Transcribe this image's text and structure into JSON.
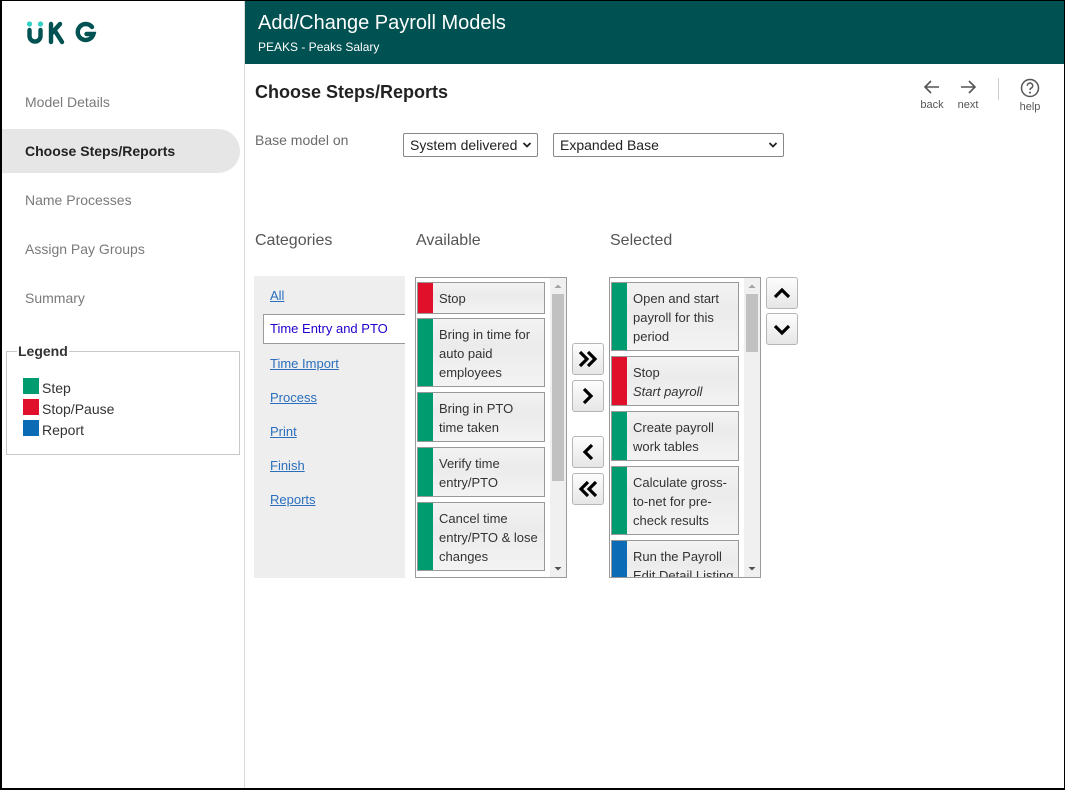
{
  "brand": {
    "logo_text": "UKG",
    "primary_color": "#005151",
    "accent_color": "#33d0c5"
  },
  "header": {
    "title": "Add/Change Payroll Models",
    "subtitle": "PEAKS - Peaks Salary"
  },
  "sidebar": {
    "items": [
      {
        "label": "Model Details",
        "active": false
      },
      {
        "label": "Choose Steps/Reports",
        "active": true
      },
      {
        "label": "Name Processes",
        "active": false
      },
      {
        "label": "Assign Pay Groups",
        "active": false
      },
      {
        "label": "Summary",
        "active": false
      }
    ],
    "legend": {
      "title": "Legend",
      "items": [
        {
          "label": "Step",
          "color": "#009b6e"
        },
        {
          "label": "Stop/Pause",
          "color": "#e0102a"
        },
        {
          "label": "Report",
          "color": "#0b6cb5"
        }
      ]
    }
  },
  "main": {
    "title": "Choose Steps/Reports",
    "toolbar": {
      "back": "back",
      "next": "next",
      "help": "help"
    },
    "base_model": {
      "label": "Base model on",
      "source_select": "System delivered",
      "model_select": "Expanded Base"
    },
    "columns": {
      "categories": "Categories",
      "available": "Available",
      "selected": "Selected"
    },
    "categories": [
      {
        "label": "All"
      },
      {
        "label": "Time Entry and PTO",
        "selected": true
      },
      {
        "label": "Time Import"
      },
      {
        "label": "Process"
      },
      {
        "label": "Print"
      },
      {
        "label": "Finish"
      },
      {
        "label": "Reports"
      }
    ],
    "available": [
      {
        "label": "Stop",
        "type": "stop"
      },
      {
        "label": "Bring in time for auto paid employees",
        "type": "step"
      },
      {
        "label": "Bring in PTO time taken",
        "type": "step"
      },
      {
        "label": "Verify time entry/PTO",
        "type": "step"
      },
      {
        "label": "Cancel time entry/PTO & lose changes",
        "type": "step"
      }
    ],
    "selected": [
      {
        "label": "Open and start payroll for this period",
        "type": "step"
      },
      {
        "label": "Stop",
        "sublabel": "Start payroll",
        "type": "stop"
      },
      {
        "label": "Create payroll work tables",
        "type": "step"
      },
      {
        "label": "Calculate gross-to-net for pre-check results",
        "type": "step"
      },
      {
        "label": "Run the Payroll Edit Detail Listing",
        "type": "report"
      }
    ],
    "move_buttons": {
      "add_all": "add-all",
      "add": "add",
      "remove": "remove",
      "remove_all": "remove-all",
      "move_up": "move-up",
      "move_down": "move-down"
    }
  }
}
